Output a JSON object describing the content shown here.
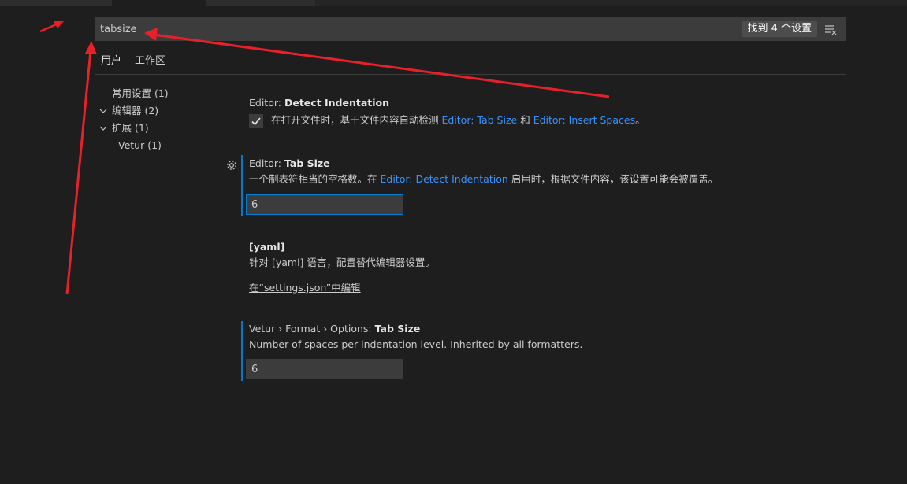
{
  "search": {
    "value": "tabsize",
    "result_count": "找到 4 个设置"
  },
  "scope_tabs": {
    "user": "用户",
    "workspace": "工作区"
  },
  "toc": [
    {
      "label": "常用设置 (1)",
      "expandable": false
    },
    {
      "label": "编辑器 (2)",
      "expandable": true
    },
    {
      "label": "扩展 (1)",
      "expandable": true
    },
    {
      "label": "Vetur (1)",
      "expandable": false
    }
  ],
  "settings": {
    "detect_indentation": {
      "title_prefix": "Editor: ",
      "title_bold": "Detect Indentation",
      "desc_a": "在打开文件时，基于文件内容自动检测 ",
      "link_1": "Editor: Tab Size",
      "desc_b": " 和 ",
      "link_2": "Editor: Insert Spaces",
      "desc_c": "。",
      "checked": true
    },
    "tab_size": {
      "title_prefix": "Editor: ",
      "title_bold": "Tab Size",
      "desc_a": "一个制表符相当的空格数。在 ",
      "link_1": "Editor: Detect Indentation",
      "desc_b": " 启用时，根据文件内容，该设置可能会被覆盖。",
      "value": "6"
    },
    "yaml": {
      "title_bold": "[yaml]",
      "desc": "针对 [yaml] 语言，配置替代编辑器设置。",
      "edit_link": "在“settings.json”中编辑"
    },
    "vetur_tab_size": {
      "title_prefix": "Vetur › Format › Options: ",
      "title_bold": "Tab Size",
      "desc": "Number of spaces per indentation level. Inherited by all formatters.",
      "value": "6"
    }
  },
  "icons": {
    "clear": "clear-filter-icon",
    "gear": "gear-icon",
    "chevron": "chevron-down-icon",
    "check": "check-icon"
  },
  "colors": {
    "background": "#1e1e1e",
    "accent": "#007acc",
    "link": "#3794ff",
    "annotation_arrow": "#e8202a"
  }
}
